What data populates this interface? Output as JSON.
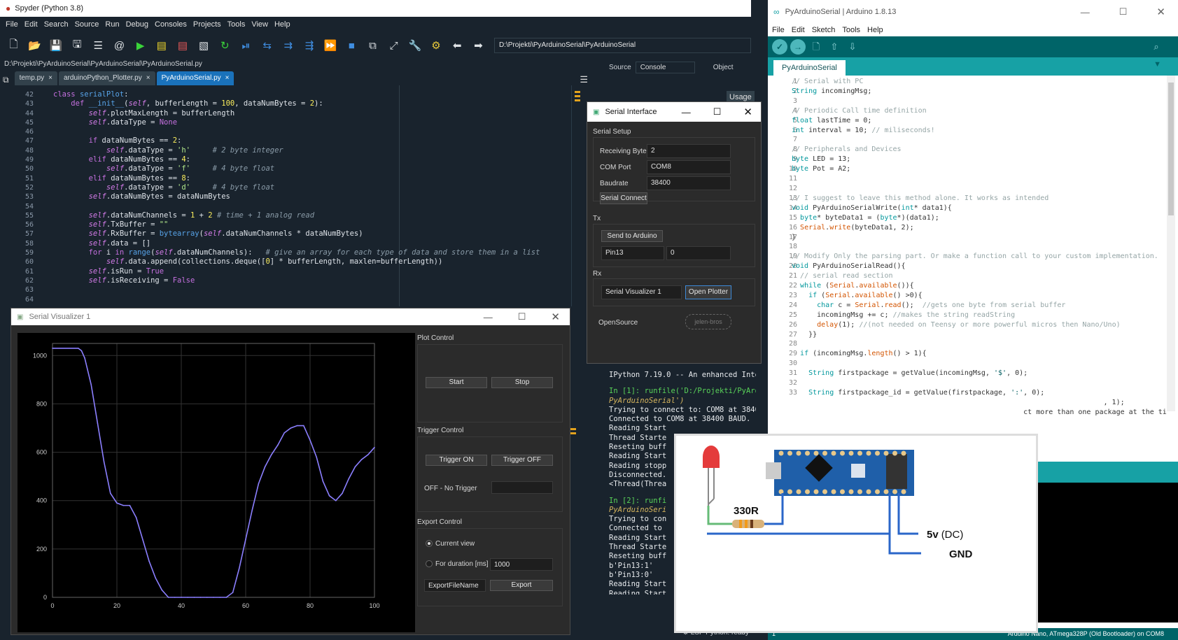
{
  "spyder": {
    "title": "Spyder (Python 3.8)",
    "menu": [
      "File",
      "Edit",
      "Search",
      "Source",
      "Run",
      "Debug",
      "Consoles",
      "Projects",
      "Tools",
      "View",
      "Help"
    ],
    "path_box": "D:\\Projekti\\PyArduinoSerial\\PyArduinoSerial",
    "file_path": "D:\\Projekti\\PyArduinoSerial\\PyArduinoSerial\\PyArduinoSerial.py",
    "tabs": [
      "temp.py",
      "arduinoPython_Plotter.py",
      "PyArduinoSerial.py"
    ],
    "line_numbers": [
      "42",
      "43",
      "44",
      "45",
      "46",
      "47",
      "48",
      "49",
      "50",
      "51",
      "52",
      "53",
      "54",
      "55",
      "56",
      "57",
      "58",
      "59",
      "60",
      "61",
      "62",
      "63",
      "64"
    ],
    "source_label": "Source",
    "source_value": "Console",
    "object_label": "Object",
    "usage_label": "Usage",
    "status": "LSP Python: ready"
  },
  "console_lines": [
    "IPython 7.19.0 -- An enhanced Inter",
    "In [1]: runfile('D:/Projekti/PyArdu",
    "PyArduinoSerial')",
    "Trying to connect to: COM8 at 38400",
    "Connected to COM8 at 38400 BAUD.",
    "Reading Start",
    "Thread Starte",
    "Reseting buff",
    "Reading Start",
    "Reading stopp",
    "Disconnected.",
    "<Thread(Threa",
    "In [2]: runfi",
    "PyArduinoSeri",
    "Trying to con",
    "Connected to",
    "Reading Start",
    "Thread Starte",
    "Reseting buff",
    "b'Pin13:1'",
    "b'Pin13:0'",
    "Reading Start",
    "Reading Start"
  ],
  "serial_interface": {
    "title": "Serial Interface",
    "setup_label": "Serial Setup",
    "receiving_bytes_label": "Receiving Bytes",
    "receiving_bytes_value": "2",
    "com_port_label": "COM Port",
    "com_port_value": "COM8",
    "baudrate_label": "Baudrate",
    "baudrate_value": "38400",
    "connect_button": "Serial Connect",
    "tx_label": "Tx",
    "send_button": "Send to Arduino",
    "send_key": "Pin13",
    "send_value": "0",
    "rx_label": "Rx",
    "rx_value": "Serial Visualizer 1",
    "open_plotter_button": "Open Plotter",
    "opensource_label": "OpenSource",
    "logo_text": "jelen-bros"
  },
  "visualizer": {
    "title": "Serial Visualizer 1",
    "plot_control_label": "Plot Control",
    "start_button": "Start",
    "stop_button": "Stop",
    "trigger_control_label": "Trigger Control",
    "trigger_on_button": "Trigger ON",
    "trigger_off_button": "Trigger OFF",
    "trigger_status": "OFF - No Trigger",
    "export_control_label": "Export Control",
    "current_view_label": "Current view",
    "duration_label": "For duration [ms]",
    "duration_value": "1000",
    "export_filename_value": "ExportFileName",
    "export_button": "Export"
  },
  "chart_data": {
    "type": "line",
    "title": "",
    "xlabel": "",
    "ylabel": "",
    "xlim": [
      0,
      100
    ],
    "ylim": [
      0,
      1050
    ],
    "xticks": [
      "0",
      "20",
      "40",
      "60",
      "80",
      "100"
    ],
    "yticks": [
      "0",
      "200",
      "400",
      "600",
      "800",
      "1000"
    ],
    "grid": true,
    "series": [
      {
        "color": "#8b7fff",
        "x": [
          0,
          8,
          9,
          10,
          12,
          14,
          16,
          18,
          20,
          22,
          24,
          26,
          28,
          30,
          32,
          34,
          36,
          38,
          40,
          42,
          44,
          46,
          48,
          50,
          52,
          54,
          56,
          58,
          60,
          62,
          64,
          66,
          68,
          70,
          72,
          74,
          76,
          78,
          80,
          82,
          84,
          86,
          88,
          90,
          92,
          94,
          96,
          98,
          100
        ],
        "y": [
          1030,
          1030,
          1020,
          990,
          880,
          720,
          560,
          430,
          390,
          380,
          380,
          330,
          240,
          150,
          80,
          30,
          0,
          0,
          0,
          0,
          0,
          0,
          0,
          0,
          0,
          0,
          20,
          120,
          240,
          360,
          470,
          540,
          590,
          630,
          680,
          700,
          710,
          710,
          650,
          580,
          480,
          420,
          400,
          430,
          490,
          540,
          570,
          590,
          620
        ]
      }
    ]
  },
  "arduino": {
    "title": "PyArduinoSerial | Arduino 1.8.13",
    "menu": [
      "File",
      "Edit",
      "Sketch",
      "Tools",
      "Help"
    ],
    "tab": "PyArduinoSerial",
    "line_numbers": [
      "1",
      "2",
      "3",
      "4",
      "5",
      "6",
      "7",
      "8",
      "9",
      "10",
      "11",
      "12",
      "13",
      "14",
      "15",
      "16",
      "17",
      "18",
      "19",
      "20",
      "21",
      "22",
      "23",
      "24",
      "25",
      "26",
      "27",
      "28",
      "29",
      "30",
      "31",
      "32",
      "33"
    ],
    "status": "Arduino Nano, ATmega328P (Old Bootloader) on COM8",
    "status_line": "1"
  },
  "circuit": {
    "resistor_label": "330R",
    "vcc_label": "5v",
    "vcc_suffix": "(DC)",
    "gnd_label": "GND"
  },
  "colors": {
    "spyder_bg": "#19232d",
    "arduino_teal": "#006468",
    "arduino_tab": "#17a1a5",
    "plot_line": "#8b7fff"
  }
}
